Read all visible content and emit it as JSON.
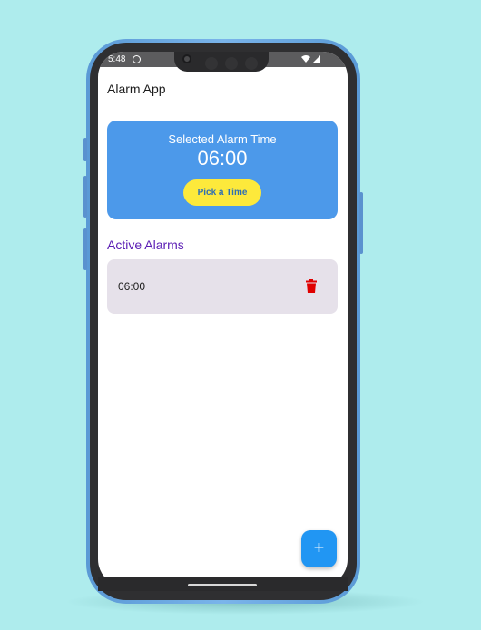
{
  "status_bar": {
    "time": "5:48",
    "right_icons": [
      "wifi-icon",
      "signal-icon"
    ]
  },
  "app_bar": {
    "title": "Alarm App"
  },
  "selected_card": {
    "label": "Selected Alarm Time",
    "time": "06:00",
    "button_label": "Pick a Time"
  },
  "active_alarms": {
    "title": "Active Alarms",
    "items": [
      {
        "time": "06:00",
        "action_icon": "trash-icon"
      }
    ]
  },
  "fab": {
    "label": "+",
    "icon": "add-icon"
  },
  "colors": {
    "background": "#aeeced",
    "card": "#4c99ea",
    "button": "#fde93b",
    "section_title": "#5a1cb4",
    "alarm_row": "#e6e1ea",
    "delete": "#e00000",
    "fab": "#2196f3"
  }
}
